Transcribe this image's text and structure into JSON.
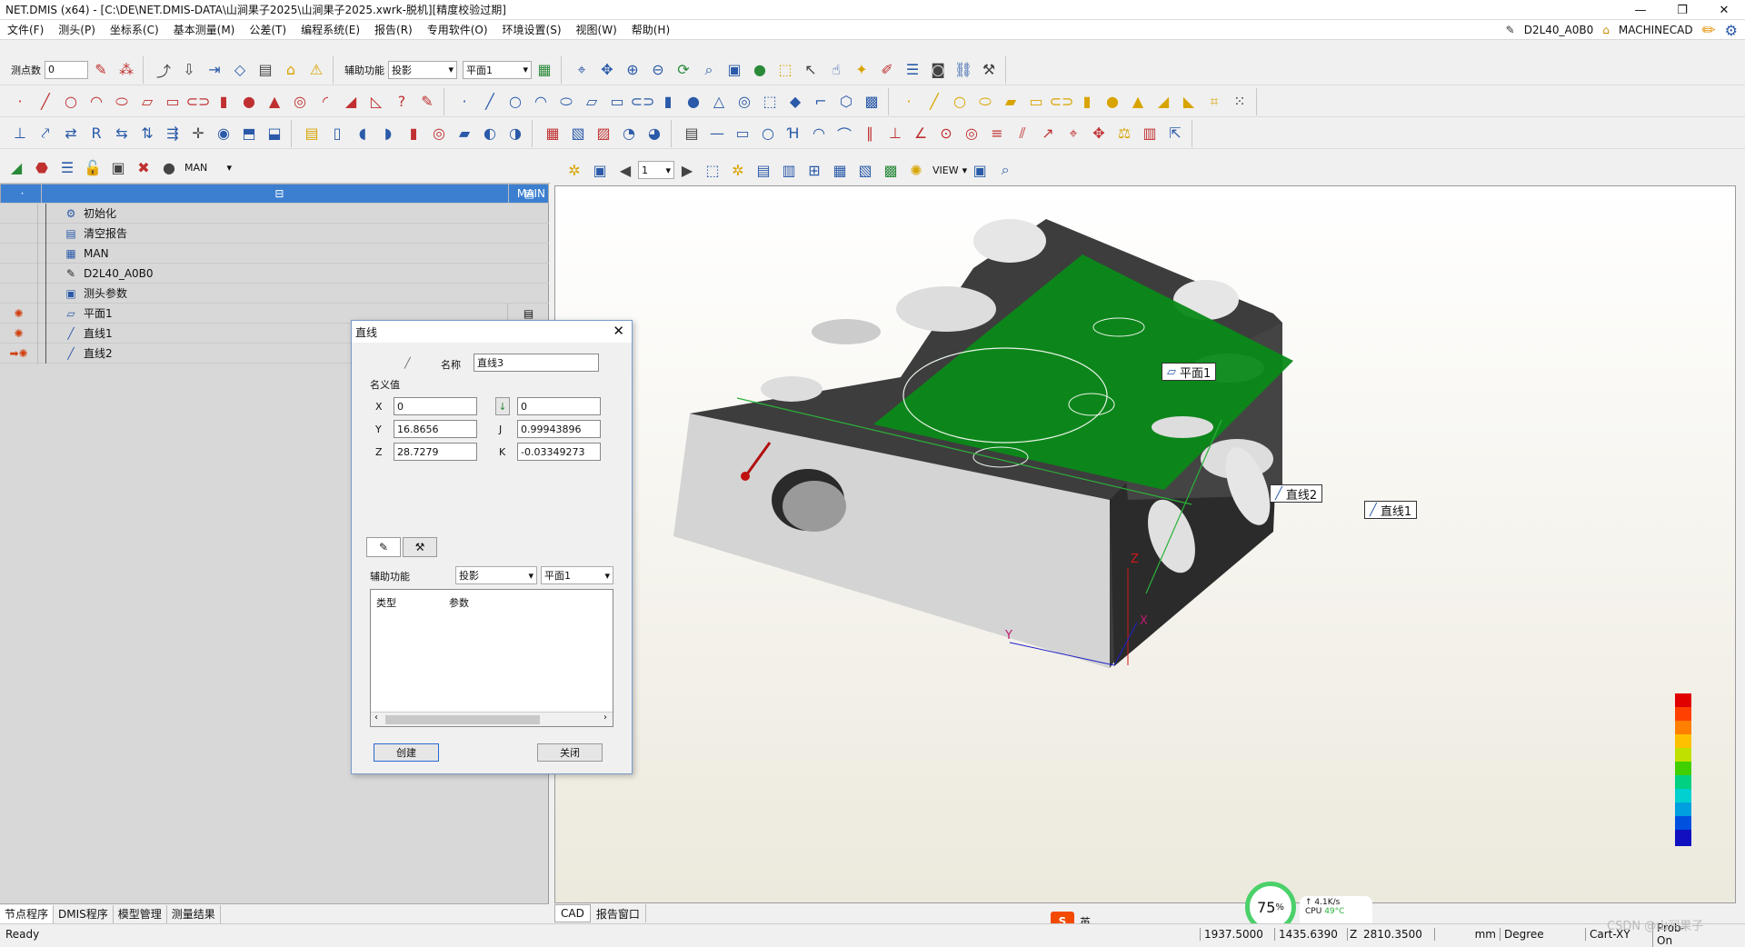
{
  "window": {
    "title": "NET.DMIS (x64) - [C:\\DE\\NET.DMIS-DATA\\山涧果子2025\\山涧果子2025.xwrk-脱机][精度校验过期]"
  },
  "menu": {
    "items": [
      "文件(F)",
      "测头(P)",
      "坐标系(C)",
      "基本测量(M)",
      "公差(T)",
      "编程系统(E)",
      "报告(R)",
      "专用软件(O)",
      "环境设置(S)",
      "视图(W)",
      "帮助(H)"
    ],
    "probe": "D2L40_A0B0",
    "machine": "MACHINECAD"
  },
  "toolbar": {
    "points_label": "测点数",
    "points_value": "0",
    "aux_label": "辅助功能",
    "aux_value": "投影",
    "plane_value": "平面1",
    "mode_value": "MAN",
    "view_value": "VIEW",
    "page_value": "1"
  },
  "tree": {
    "items": [
      {
        "label": "MAIN"
      },
      {
        "label": "初始化"
      },
      {
        "label": "清空报告"
      },
      {
        "label": "MAN"
      },
      {
        "label": "D2L40_A0B0"
      },
      {
        "label": "测头参数"
      },
      {
        "label": "平面1"
      },
      {
        "label": "直线1"
      },
      {
        "label": "直线2"
      }
    ]
  },
  "left_tabs": [
    "节点程序",
    "DMIS程序",
    "模型管理",
    "测量结果"
  ],
  "cad_tabs": [
    "CAD",
    "报告窗口"
  ],
  "dialog": {
    "title": "直线",
    "name_label": "名称",
    "name_value": "直线3",
    "nominal_label": "名义值",
    "x_label": "X",
    "x_value": "0",
    "y_label": "Y",
    "y_value": "16.8656",
    "z_label": "Z",
    "z_value": "28.7279",
    "i_value": "0",
    "j_label": "J",
    "j_value": "0.99943896",
    "k_label": "K",
    "k_value": "-0.03349273",
    "aux_label": "辅助功能",
    "aux_value": "投影",
    "plane_value": "平面1",
    "col_type": "类型",
    "col_param": "参数",
    "create_button": "创建",
    "close_button": "关闭"
  },
  "cad": {
    "tags": {
      "plane": "平面1",
      "line2": "直线2",
      "line1": "直线1"
    },
    "axes": {
      "z": "Z",
      "y": "Y",
      "x": "X"
    }
  },
  "status": {
    "ready": "Ready",
    "x": "1937.5000",
    "y": "1435.6390",
    "z_label": "Z",
    "z": "2810.3500",
    "unit": "mm",
    "angle": "Degree",
    "coord": "Cart-XY",
    "probe": "Prob-On"
  },
  "perf": {
    "percent": "75",
    "net": "4.1K/s",
    "cpu_label": "CPU",
    "cpu_temp": "49°C"
  },
  "ime": {
    "lang": "英"
  },
  "watermark": "CSDN @山涧果子"
}
